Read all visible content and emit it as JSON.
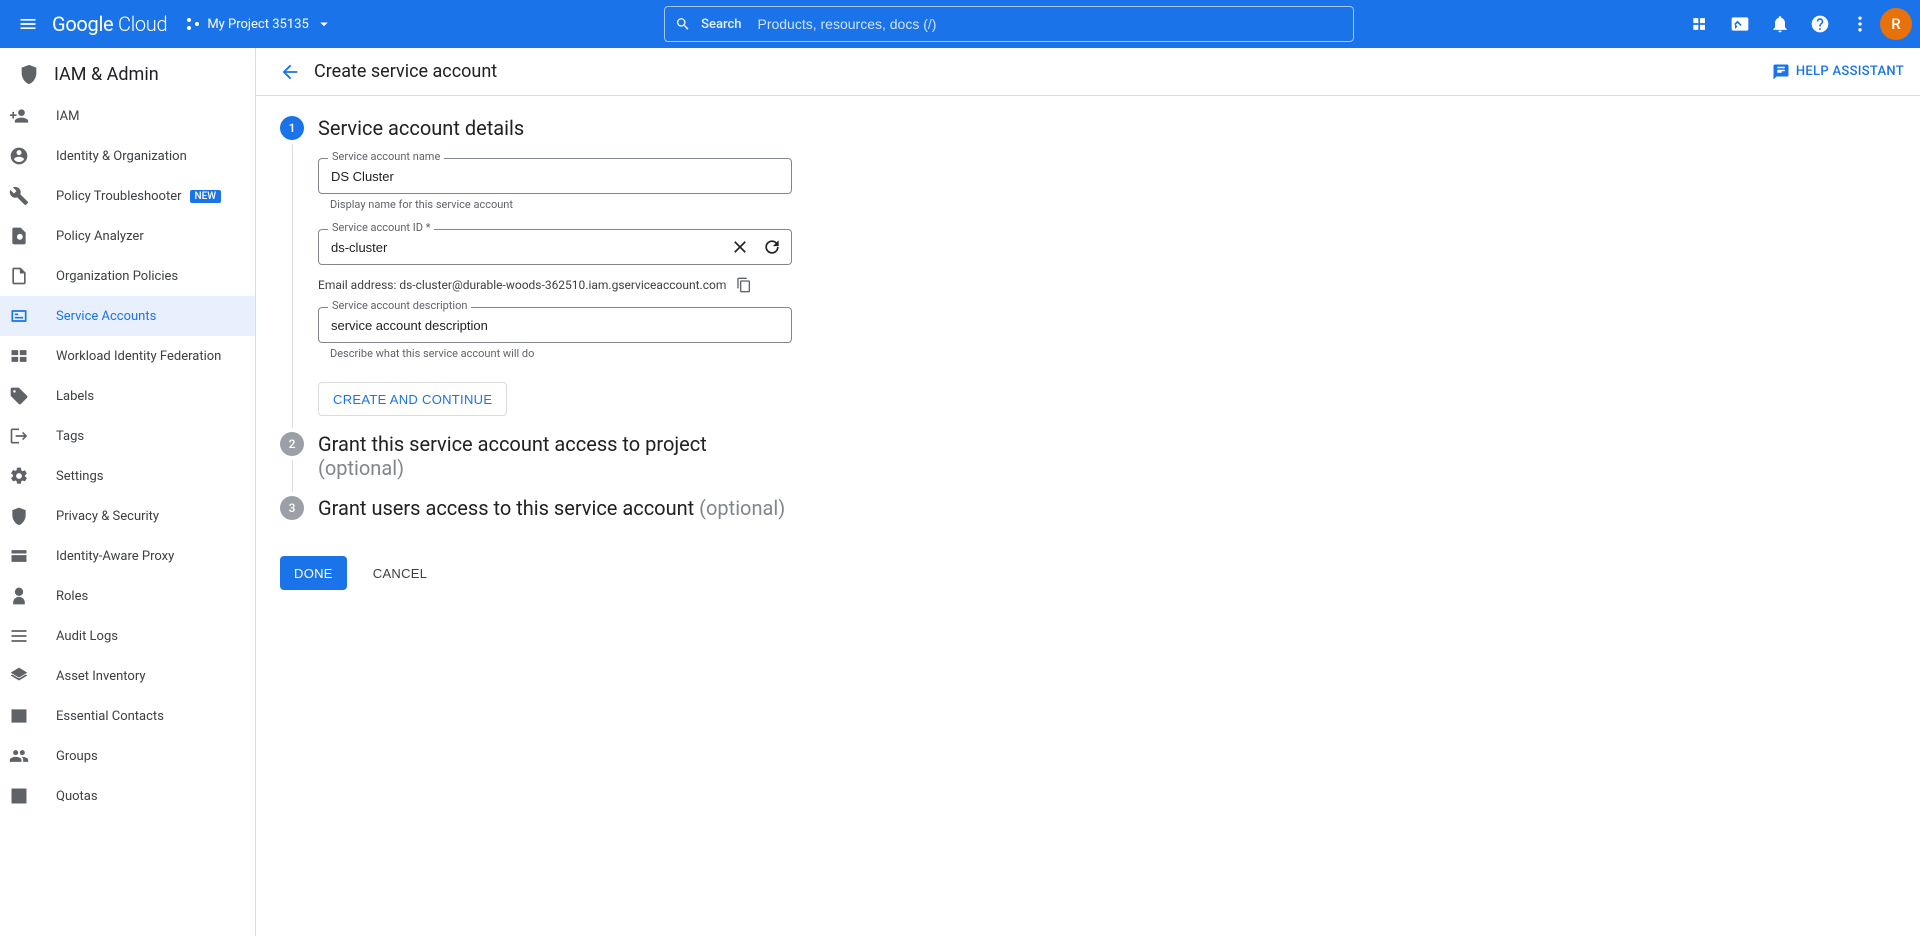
{
  "topbar": {
    "logo_a": "Google",
    "logo_b": "Cloud",
    "project_name": "My Project 35135",
    "search_label": "Search",
    "search_placeholder": "Products, resources, docs (/)",
    "avatar_initial": "R"
  },
  "sidebar": {
    "section": "IAM & Admin",
    "items": [
      {
        "label": "IAM",
        "icon": "person-add"
      },
      {
        "label": "Identity & Organization",
        "icon": "account-circle"
      },
      {
        "label": "Policy Troubleshooter",
        "icon": "wrench",
        "badge": "NEW"
      },
      {
        "label": "Policy Analyzer",
        "icon": "doc-search"
      },
      {
        "label": "Organization Policies",
        "icon": "doc"
      },
      {
        "label": "Service Accounts",
        "icon": "id-card",
        "active": true
      },
      {
        "label": "Workload Identity Federation",
        "icon": "federation"
      },
      {
        "label": "Labels",
        "icon": "tag"
      },
      {
        "label": "Tags",
        "icon": "tag-arrow"
      },
      {
        "label": "Settings",
        "icon": "gear"
      },
      {
        "label": "Privacy & Security",
        "icon": "shield"
      },
      {
        "label": "Identity-Aware Proxy",
        "icon": "iap"
      },
      {
        "label": "Roles",
        "icon": "roles"
      },
      {
        "label": "Audit Logs",
        "icon": "list"
      },
      {
        "label": "Asset Inventory",
        "icon": "layers"
      },
      {
        "label": "Essential Contacts",
        "icon": "contacts"
      },
      {
        "label": "Groups",
        "icon": "groups"
      },
      {
        "label": "Quotas",
        "icon": "quota"
      }
    ]
  },
  "page": {
    "title": "Create service account",
    "help_assistant": "HELP ASSISTANT"
  },
  "step1": {
    "title": "Service account details",
    "name_label": "Service account name",
    "name_value": "DS Cluster",
    "name_helper": "Display name for this service account",
    "id_label": "Service account ID *",
    "id_value": "ds-cluster",
    "email_prefix": "Email address: ",
    "email_value": "ds-cluster@durable-woods-362510.iam.gserviceaccount.com",
    "desc_label": "Service account description",
    "desc_value": "service account description",
    "desc_helper": "Describe what this service account will do",
    "create_continue": "CREATE AND CONTINUE"
  },
  "step2": {
    "title": "Grant this service account access to project",
    "optional": "(optional)"
  },
  "step3": {
    "title": "Grant users access to this service account ",
    "optional": "(optional)"
  },
  "footer": {
    "done": "DONE",
    "cancel": "CANCEL"
  }
}
